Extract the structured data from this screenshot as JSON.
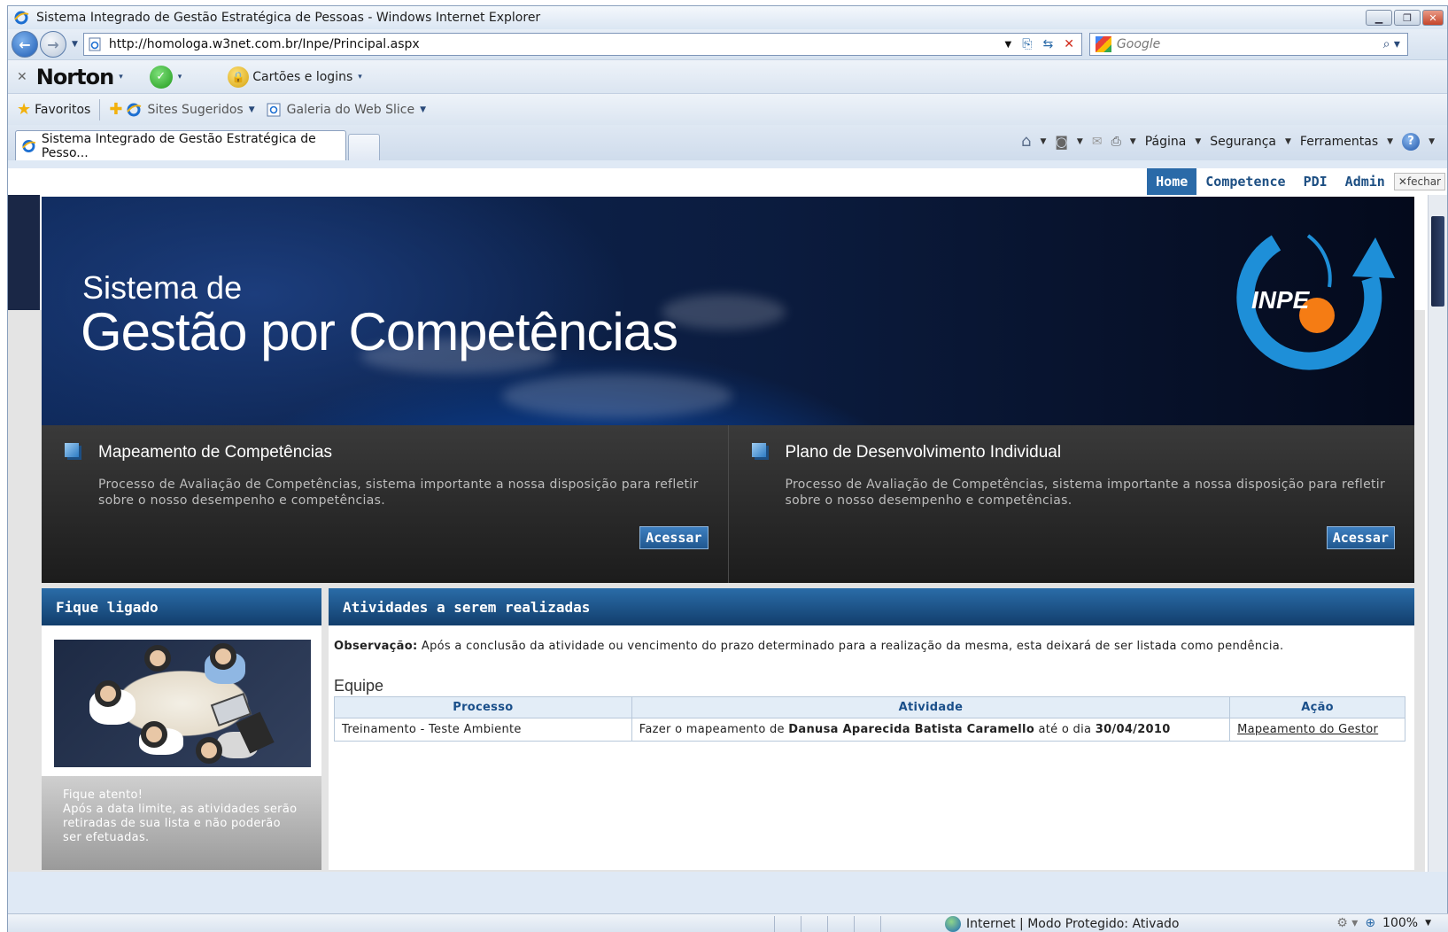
{
  "window": {
    "title": "Sistema Integrado de Gestão Estratégica de Pessoas - Windows Internet Explorer"
  },
  "address": {
    "url": "http://homologa.w3net.com.br/Inpe/Principal.aspx",
    "search_placeholder": "Google"
  },
  "norton": {
    "brand": "Norton",
    "cards_label": "Cartões e logins"
  },
  "favorites": {
    "favorites_label": "Favoritos",
    "suggested_sites": "Sites Sugeridos",
    "web_slice": "Galeria do Web Slice"
  },
  "tab": {
    "title": "Sistema Integrado de Gestão Estratégica de Pesso..."
  },
  "commands": {
    "page": "Página",
    "security": "Segurança",
    "tools": "Ferramentas"
  },
  "topnav": {
    "home": "Home",
    "competence": "Competence",
    "pdi": "PDI",
    "admin": "Admin",
    "close": "fechar"
  },
  "hero": {
    "subtitle": "Sistema de",
    "title": "Gestão por Competências",
    "logo_text": "INPE"
  },
  "cards": [
    {
      "title": "Mapeamento de Competências",
      "description": "Processo de Avaliação de Competências, sistema importante a nossa disposição para refletir sobre o nosso desempenho e competências.",
      "button": "Acessar"
    },
    {
      "title": "Plano de Desenvolvimento Individual",
      "description": "Processo de Avaliação de Competências, sistema importante a nossa disposição para refletir sobre o nosso desempenho e competências.",
      "button": "Acessar"
    }
  ],
  "sidebar": {
    "title": "Fique ligado",
    "notice_title": "Fique atento!",
    "notice_text": "Após a data limite, as atividades serão retiradas de sua lista e não poderão ser efetuadas."
  },
  "activities": {
    "title": "Atividades a serem realizadas",
    "obs_label": "Observação:",
    "obs_text": " Após a conclusão da atividade ou vencimento do prazo determinado para a realização da mesma, esta deixará de ser listada como pendência.",
    "section": "Equipe",
    "columns": [
      "Processo",
      "Atividade",
      "Ação"
    ],
    "rows": [
      {
        "process": "Treinamento - Teste Ambiente",
        "activity_prefix": "Fazer o mapeamento de ",
        "person": "Danusa Aparecida Batista Caramello",
        "activity_mid": " até o dia ",
        "date": "30/04/2010",
        "action": "Mapeamento do Gestor"
      }
    ]
  },
  "status": {
    "zone": "Internet | Modo Protegido: Ativado",
    "zoom": "100%"
  },
  "colors": {
    "accent": "#2a6aa8",
    "dark_panel": "#2a2a2a",
    "header_blue": "#1d4f83"
  }
}
